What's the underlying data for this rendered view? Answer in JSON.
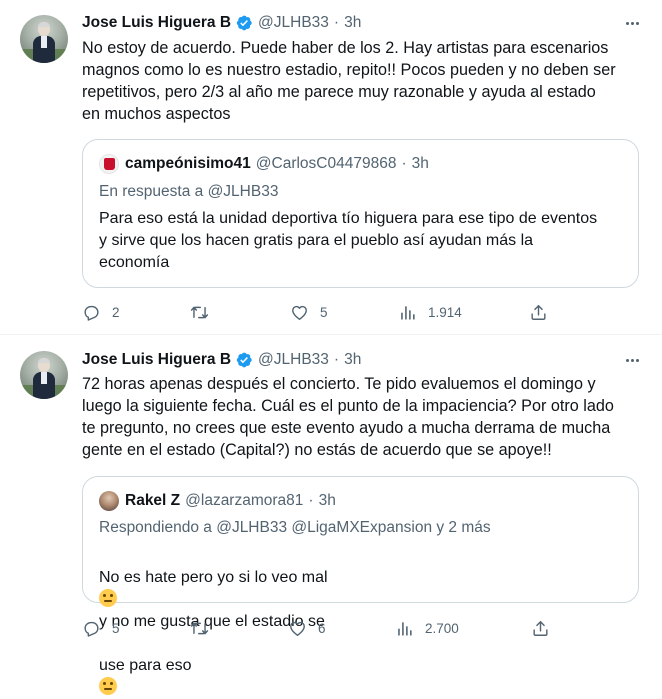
{
  "tweets": [
    {
      "author": {
        "name": "Jose Luis Higuera B",
        "handle": "@JLHB33",
        "dot": "·",
        "time": "3h",
        "verified": true
      },
      "text": "No estoy de acuerdo. Puede haber de los 2. Hay artistas para escenarios\nmagnos como lo es nuestro estadio, repito!! Pocos pueden y no deben ser\nrepetitivos, pero 2/3 al año me parece muy razonable y ayuda al estado\nen muchos aspectos",
      "quoted": {
        "name": "campeónisimo41",
        "handle": "@CarlosC04479868",
        "dot": "·",
        "time": "3h",
        "reply_to": "En respuesta a @JLHB33",
        "text": "Para eso está la unidad deportiva tío higuera para ese tipo de eventos\ny sirve que los hacen gratis para el pueblo así ayudan más la\neconomía"
      },
      "stats": {
        "replies": "2",
        "retweets": "",
        "likes": "5",
        "views": "1.914"
      }
    },
    {
      "author": {
        "name": "Jose Luis Higuera B",
        "handle": "@JLHB33",
        "dot": "·",
        "time": "3h",
        "verified": true
      },
      "text": "72 horas apenas después el concierto. Te pido evaluemos el domingo y\nluego la siguiente fecha. Cuál es el punto de la impaciencia? Por otro lado\nte pregunto, no crees que este evento ayudo a mucha derrama de mucha\ngente en el estado (Capital?) no estás de acuerdo que se apoye!!",
      "quoted": {
        "name": "Rakel Z",
        "handle": "@lazarzamora81",
        "dot": "·",
        "time": "3h",
        "reply_to": "Respondiendo a @JLHB33 @LigaMXExpansion y 2 más",
        "text_line1_a": "No es hate pero yo si lo veo mal",
        "text_line1_b": "y no me gusta que el estadio se",
        "text_line2": "use para eso"
      },
      "stats": {
        "replies": "5",
        "retweets": "",
        "likes": "6",
        "views": "2.700"
      }
    }
  ],
  "icons": {
    "verified": "verified-badge-icon",
    "more": "more-options-icon",
    "reply": "reply-icon",
    "retweet": "retweet-icon",
    "like": "like-icon",
    "views": "views-icon",
    "share": "share-icon"
  },
  "colors": {
    "verified": "#1d9bf0",
    "secondary_text": "#536471",
    "border": "#cfd9de"
  }
}
